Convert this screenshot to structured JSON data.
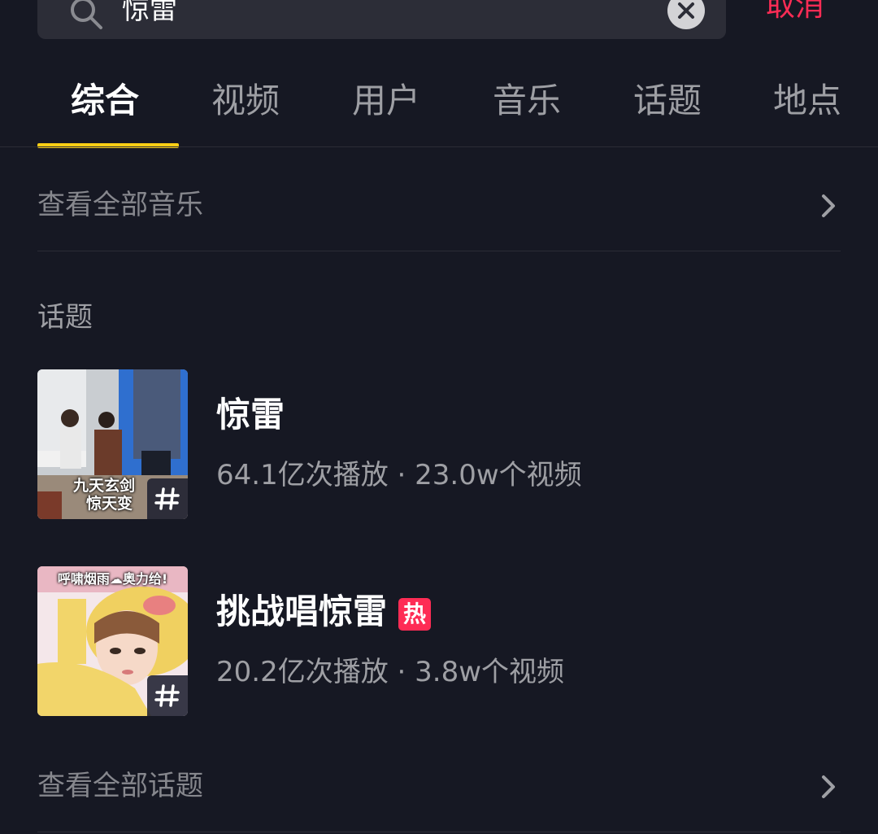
{
  "search": {
    "query": "惊雷",
    "cancel_label": "取消"
  },
  "tabs": [
    {
      "label": "综合",
      "active": true
    },
    {
      "label": "视频",
      "active": false
    },
    {
      "label": "用户",
      "active": false
    },
    {
      "label": "音乐",
      "active": false
    },
    {
      "label": "话题",
      "active": false
    },
    {
      "label": "地点",
      "active": false
    }
  ],
  "music": {
    "see_all_label": "查看全部音乐"
  },
  "topics_section": {
    "title": "话题",
    "items": [
      {
        "title": "惊雷",
        "stats": "64.1亿次播放 · 23.0w个视频",
        "hot": false,
        "thumb_caption_line1": "九天玄剑",
        "thumb_caption_line2": "惊天变"
      },
      {
        "title": "挑战唱惊雷",
        "stats": "20.2亿次播放 · 3.8w个视频",
        "hot": true,
        "hot_label": "热",
        "thumb_banner": "呼啸烟雨☁奥力给!"
      }
    ],
    "see_all_label": "查看全部话题"
  },
  "colors": {
    "background": "#161823",
    "accent_yellow": "#face15",
    "accent_red": "#fe2c55"
  }
}
